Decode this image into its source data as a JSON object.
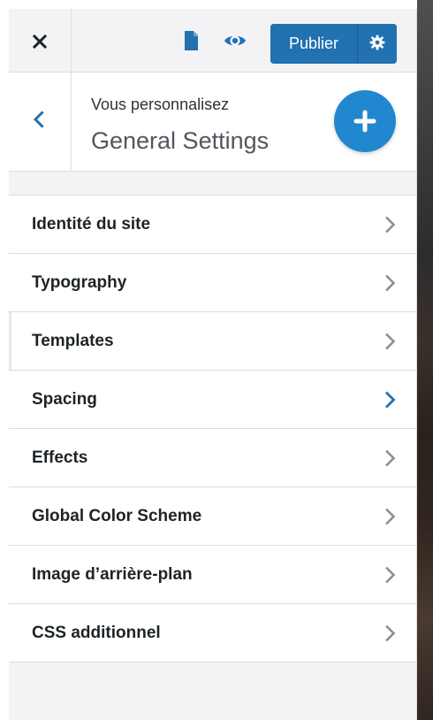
{
  "header": {
    "close_icon": "close-icon",
    "file_icon": "document-icon",
    "eye_icon": "eye-icon",
    "publish_label": "Publier",
    "settings_icon": "gear-icon"
  },
  "section": {
    "kicker": "Vous personnalisez",
    "title": "General Settings",
    "back_icon": "chevron-left-icon",
    "add_icon": "plus-icon"
  },
  "menu": {
    "items": [
      {
        "label": "Identité du site"
      },
      {
        "label": "Typography"
      },
      {
        "label": "Templates"
      },
      {
        "label": "Spacing"
      },
      {
        "label": "Effects"
      },
      {
        "label": "Global Color Scheme"
      },
      {
        "label": "Image d’arrière-plan"
      },
      {
        "label": "CSS additionnel"
      }
    ]
  },
  "colors": {
    "primary": "#2271b1",
    "fab": "#2188d0",
    "text_dark": "#1d2327",
    "text_muted": "#50575e",
    "chevron_default": "#8c8f94",
    "chevron_active": "#2271b1"
  }
}
